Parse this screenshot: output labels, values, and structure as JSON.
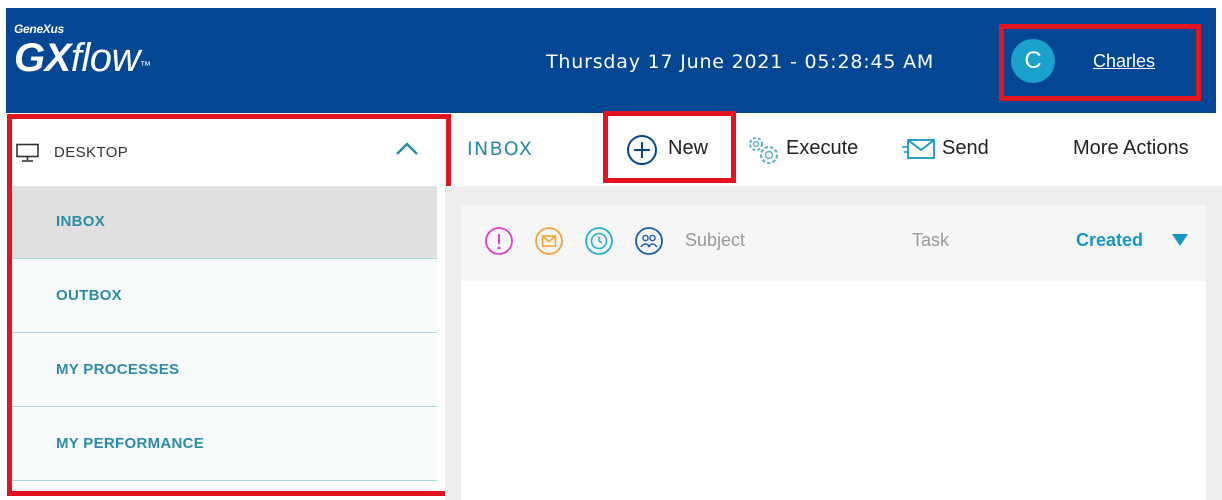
{
  "header": {
    "logo_top": "GeneXus",
    "logo_gx": "GX",
    "logo_flow": "flow",
    "logo_tm": "™",
    "datetime": "Thursday 17 June 2021 - 05:28:45 AM",
    "avatar_initial": "C",
    "user_name": "Charles"
  },
  "sidebar": {
    "section_label": "DESKTOP",
    "items": [
      {
        "label": "INBOX",
        "active": true
      },
      {
        "label": "OUTBOX",
        "active": false
      },
      {
        "label": "MY PROCESSES",
        "active": false
      },
      {
        "label": "MY PERFORMANCE",
        "active": false
      }
    ]
  },
  "toolbar": {
    "title": "INBOX",
    "new_label": "New",
    "execute_label": "Execute",
    "send_label": "Send",
    "more_label": "More Actions"
  },
  "table": {
    "columns": [
      "Subject",
      "Task",
      "Created"
    ],
    "icons": [
      "priority-icon",
      "message-icon",
      "clock-icon",
      "users-icon"
    ],
    "sort_column": "Created"
  },
  "colors": {
    "header_bg": "#024694",
    "accent_teal": "#2c8ca6",
    "highlight_red": "#e3141f",
    "avatar_bg": "#1aa2cc",
    "priority": "#e43bd0",
    "message": "#f2a33a",
    "clock": "#23b5c9",
    "users": "#1c5fa8",
    "sort_active": "#1797c5"
  }
}
